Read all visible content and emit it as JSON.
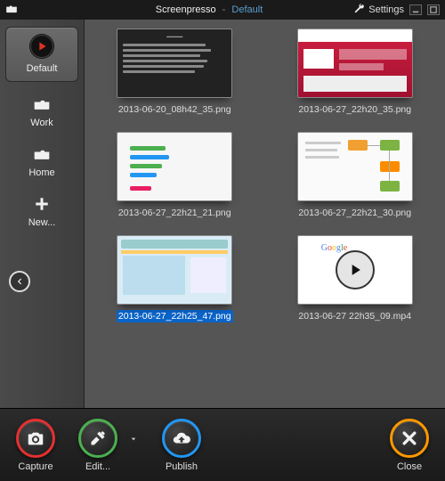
{
  "titlebar": {
    "app": "Screenpresso",
    "separator": "-",
    "workspace": "Default",
    "settings_label": "Settings"
  },
  "sidebar": {
    "items": [
      {
        "label": "Default",
        "icon": "default-logo"
      },
      {
        "label": "Work",
        "icon": "folder-icon"
      },
      {
        "label": "Home",
        "icon": "folder-icon"
      },
      {
        "label": "New...",
        "icon": "plus-icon"
      }
    ]
  },
  "grid": {
    "items": [
      {
        "filename": "2013-06-20_08h42_35.png",
        "selected": false,
        "kind": "dark"
      },
      {
        "filename": "2013-06-27_22h20_35.png",
        "selected": false,
        "kind": "red"
      },
      {
        "filename": "2013-06-27_22h21_21.png",
        "selected": false,
        "kind": "form"
      },
      {
        "filename": "2013-06-27_22h21_30.png",
        "selected": false,
        "kind": "diag"
      },
      {
        "filename": "2013-06-27_22h25_47.png",
        "selected": true,
        "kind": "blue"
      },
      {
        "filename": "2013-06-27 22h35_09.mp4",
        "selected": false,
        "kind": "video"
      }
    ]
  },
  "toolbar": {
    "capture_label": "Capture",
    "edit_label": "Edit...",
    "publish_label": "Publish",
    "close_label": "Close"
  },
  "colors": {
    "capture": "#e53030",
    "edit": "#4caf50",
    "publish": "#2196f3",
    "close": "#ff9800"
  }
}
